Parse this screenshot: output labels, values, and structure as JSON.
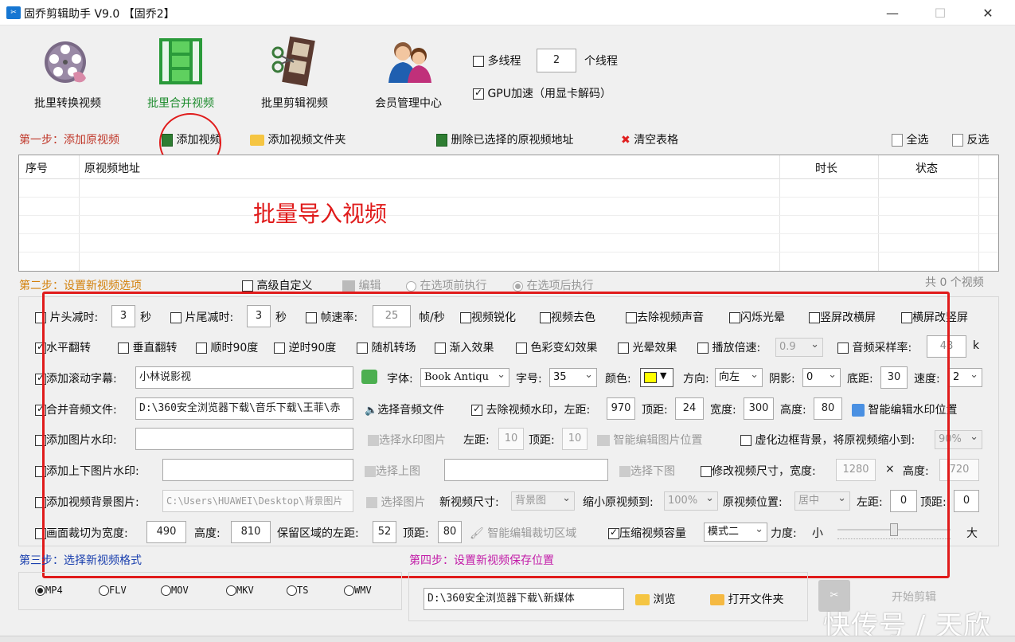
{
  "window": {
    "title": "固乔剪辑助手 V9.0 【固乔2】",
    "app_icon": "scissors-icon"
  },
  "toolbar": {
    "items": [
      {
        "label": "批里转换视频",
        "icon": "film-reel-icon",
        "color": "#111111"
      },
      {
        "label": "批里合并视频",
        "icon": "film-strip-green-icon",
        "color": "#1e8c2e"
      },
      {
        "label": "批里剪辑视频",
        "icon": "film-cut-icon",
        "color": "#111111"
      },
      {
        "label": "会员管理中心",
        "icon": "users-icon",
        "color": "#111111"
      }
    ],
    "multithread_label": "多线程",
    "thread_count": "2",
    "thread_unit": "个线程",
    "gpu_label": "GPU加速（用显卡解码）"
  },
  "step1": {
    "title": "第一步：添加原视频",
    "add_video": "添加视频",
    "add_folder": "添加视频文件夹",
    "delete_selected": "删除已选择的原视频地址",
    "clear_table": "清空表格",
    "select_all": "全选",
    "invert": "反选"
  },
  "table": {
    "columns": [
      "序号",
      "原视频地址",
      "时长",
      "状态"
    ],
    "overlay_text": "批量导入视频"
  },
  "step2": {
    "title": "第二步：设置新视频选项",
    "advanced": "高级自定义",
    "edit": "编辑",
    "before": "在选项前执行",
    "after": "在选项后执行",
    "count_text": "共 0 个视频"
  },
  "opts": {
    "head_cut": "片头减时:",
    "head_val": "3",
    "sec1": "秒",
    "tail_cut": "片尾减时:",
    "tail_val": "3",
    "sec2": "秒",
    "fps": "帧速率:",
    "fps_val": "25",
    "fps_unit": "帧/秒",
    "sharpen": "视频锐化",
    "decolor": "视频去色",
    "mute": "去除视频声音",
    "flash": "闪烁光晕",
    "v2h": "竖屏改横屏",
    "h2v": "横屏改竖屏",
    "hflip": "水平翻转",
    "vflip": "垂直翻转",
    "cw90": "顺时90度",
    "ccw90": "逆时90度",
    "random_trans": "随机转场",
    "fade": "渐入效果",
    "color_fx": "色彩变幻效果",
    "glow": "光晕效果",
    "speed": "播放倍速:",
    "speed_val": "0.9",
    "samplerate": "音频采样率:",
    "samplerate_val": "48",
    "samplerate_unit": "k",
    "scroll": "添加滚动字幕:",
    "scroll_text": "小林说影视",
    "font": "字体:",
    "font_val": "Book Antiqu",
    "size": "字号:",
    "size_val": "35",
    "color": "颜色:",
    "color_swatch": "#ffff00",
    "dir": "方向:",
    "dir_val": "向左",
    "shadow": "阴影:",
    "shadow_val": "0",
    "bottom": "底距:",
    "bottom_val": "30",
    "spd": "速度:",
    "spd_val": "2",
    "merge_audio": "合并音频文件:",
    "audio_path": "D:\\360安全浏览器下载\\音乐下载\\王菲\\赤",
    "choose_audio": "选择音频文件",
    "remove_wm": "去除视频水印，左距:",
    "wm_left": "970",
    "top": "顶距:",
    "wm_top": "24",
    "width": "宽度:",
    "wm_width": "300",
    "height": "高度:",
    "wm_height": "80",
    "smart_wm": "智能编辑水印位置",
    "img_wm": "添加图片水印:",
    "choose_wm_img": "选择水印图片",
    "left": "左距:",
    "img_left": "10",
    "img_top": "10",
    "smart_img": "智能编辑图片位置",
    "blur_bg": "虚化边框背景，将原视频缩小到:",
    "blur_val": "90%",
    "updown_wm": "添加上下图片水印:",
    "choose_top_img": "选择上图",
    "choose_bottom_img": "选择下图",
    "resize": "修改视频尺寸，宽度:",
    "resize_w": "1280",
    "times": "×",
    "height2": "高度:",
    "resize_h": "720",
    "bg_img": "添加视频背景图片:",
    "bg_path": "C:\\Users\\HUAWEI\\Desktop\\背景图片",
    "choose_img": "选择图片",
    "new_size": "新视频尺寸:",
    "new_size_val": "背景图",
    "shrink": "缩小原视频到:",
    "shrink_val": "100%",
    "pos": "原视频位置:",
    "pos_val": "居中",
    "pos_left": "0",
    "pos_top": "0",
    "crop": "画面裁切为宽度:",
    "crop_w": "490",
    "crop_h_label": "高度:",
    "crop_h": "810",
    "keep_left": "保留区域的左距:",
    "keep_left_val": "52",
    "keep_top_val": "80",
    "smart_crop": "智能编辑裁切区域",
    "compress": "压缩视频容量",
    "mode_val": "模式二",
    "strength": "力度:",
    "small": "小",
    "big": "大",
    "compress_level": 0.5
  },
  "step3": {
    "title": "第三步：选择新视频格式",
    "formats": [
      "MP4",
      "FLV",
      "MOV",
      "MKV",
      "TS",
      "WMV"
    ],
    "selected": "MP4"
  },
  "step4": {
    "title": "第四步：设置新视频保存位置",
    "path": "D:\\360安全浏览器下载\\新媒体",
    "browse": "浏览",
    "open_folder": "打开文件夹",
    "start": "开始剪辑"
  },
  "watermark": "快传号 / 天欣"
}
